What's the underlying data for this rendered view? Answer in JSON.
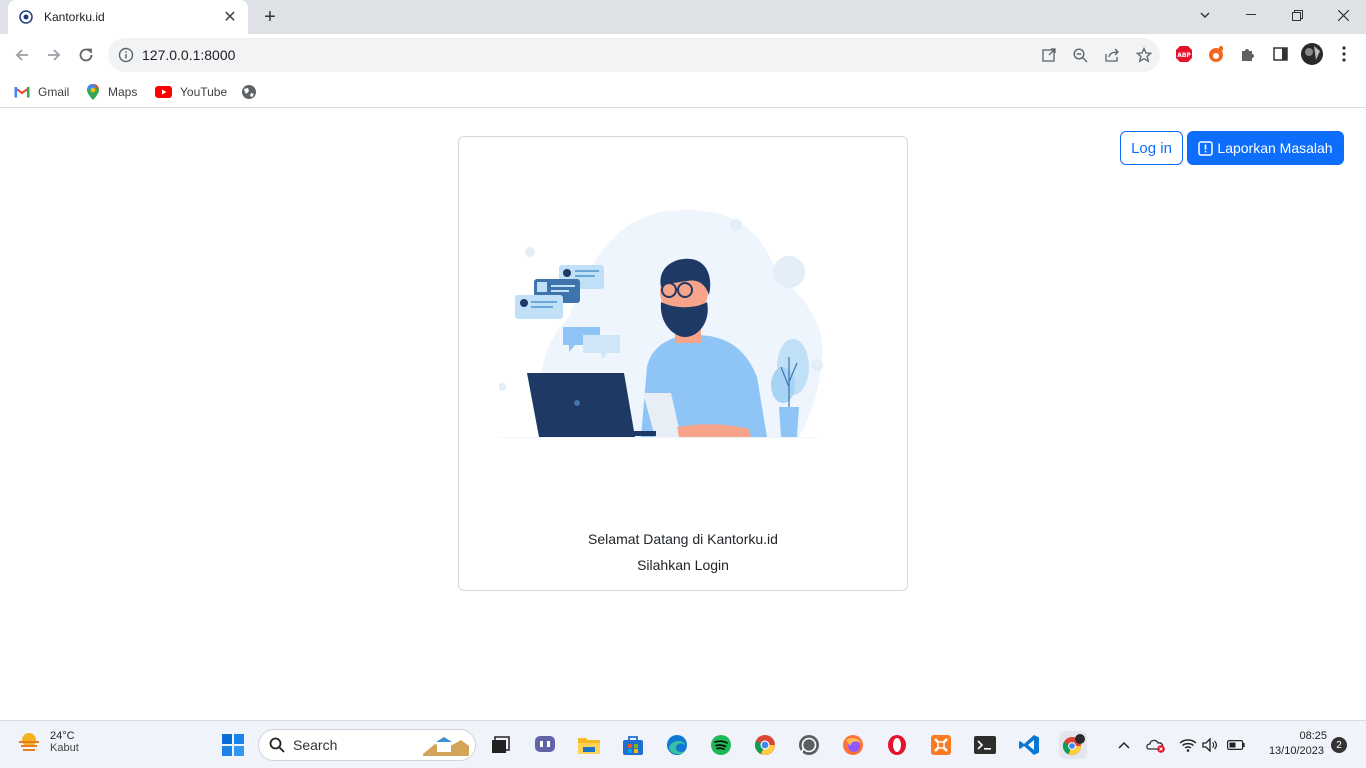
{
  "browser": {
    "tab_title": "Kantorku.id",
    "url": "127.0.0.1:8000",
    "bookmarks": [
      {
        "label": "Gmail",
        "icon": "gmail-icon"
      },
      {
        "label": "Maps",
        "icon": "maps-icon"
      },
      {
        "label": "YouTube",
        "icon": "youtube-icon"
      }
    ]
  },
  "header": {
    "login_label": "Log in",
    "report_label": "Laporkan Masalah"
  },
  "card": {
    "welcome": "Selamat Datang di Kantorku.id",
    "hint": "Silahkan Login"
  },
  "taskbar": {
    "weather_temp": "24°C",
    "weather_cond": "Kabut",
    "search_label": "Search",
    "time": "08:25",
    "date": "13/10/2023",
    "notification_count": "2"
  },
  "colors": {
    "primary": "#0d6efd",
    "tabstrip": "#dee1e6",
    "illustration_dark": "#1e3a64",
    "illustration_light": "#8ec5f6"
  }
}
